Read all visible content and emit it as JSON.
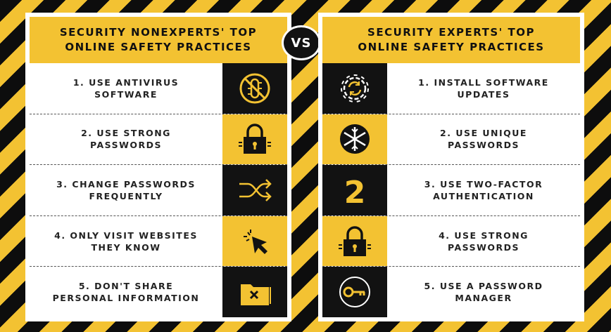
{
  "left": {
    "title_line1": "SECURITY NONEXPERTS' TOP",
    "title_line2": "ONLINE SAFETY PRACTICES",
    "items": [
      {
        "text": "1. USE ANTIVIRUS\nSOFTWARE",
        "icon": "no-bug-icon"
      },
      {
        "text": "2. USE STRONG\nPASSWORDS",
        "icon": "padlock-icon"
      },
      {
        "text": "3. CHANGE PASSWORDS\nFREQUENTLY",
        "icon": "shuffle-icon"
      },
      {
        "text": "4. ONLY VISIT WEBSITES\nTHEY KNOW",
        "icon": "cursor-click-icon"
      },
      {
        "text": "5. DON'T SHARE\nPERSONAL INFORMATION",
        "icon": "folder-x-icon"
      }
    ]
  },
  "vs_label": "VS",
  "right": {
    "title_line1": "SECURITY EXPERTS' TOP",
    "title_line2": "ONLINE SAFETY PRACTICES",
    "items": [
      {
        "text": "1. INSTALL SOFTWARE\nUPDATES",
        "icon": "gear-refresh-icon"
      },
      {
        "text": "2. USE UNIQUE\nPASSWORDS",
        "icon": "snowflake-icon"
      },
      {
        "text": "3. USE TWO-FACTOR\nAUTHENTICATION",
        "icon": "number-two-icon",
        "icon_text": "2"
      },
      {
        "text": "4. USE STRONG\nPASSWORDS",
        "icon": "padlock-icon"
      },
      {
        "text": "5. USE A PASSWORD\nMANAGER",
        "icon": "key-icon"
      }
    ]
  },
  "colors": {
    "yellow": "#f3c232",
    "black": "#121212"
  }
}
